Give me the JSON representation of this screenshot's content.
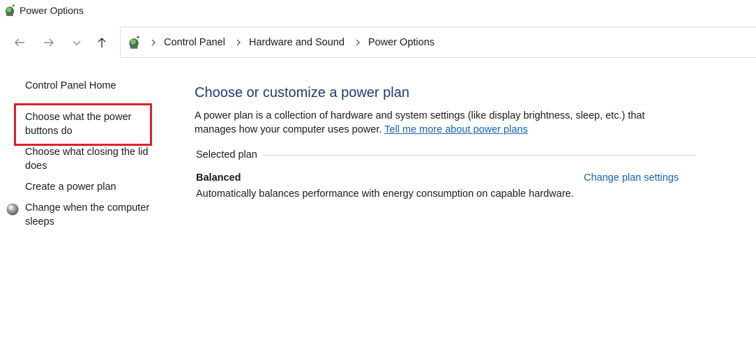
{
  "window": {
    "title": "Power Options"
  },
  "breadcrumb": [
    "Control Panel",
    "Hardware and Sound",
    "Power Options"
  ],
  "sidebar": {
    "items": [
      "Control Panel Home",
      "Choose what the power buttons do",
      "Choose what closing the lid does",
      "Create a power plan",
      "Change when the computer sleeps"
    ]
  },
  "main": {
    "title": "Choose or customize a power plan",
    "description": "A power plan is a collection of hardware and system settings (like display brightness, sleep, etc.) that manages how your computer uses power. ",
    "learn_more_link": "Tell me more about power plans",
    "section_label": "Selected plan",
    "plan": {
      "name": "Balanced",
      "settings_link": "Change plan settings",
      "description": "Automatically balances performance with energy consumption on capable hardware."
    }
  },
  "colors": {
    "highlight": "#e0202a",
    "link": "#1560c4",
    "title": "#1e3c78"
  },
  "icons": {
    "app": "power-options-icon",
    "back": "arrow-left-icon",
    "forward": "arrow-right-icon",
    "recent": "chevron-down-icon",
    "up": "arrow-up-icon",
    "sleep": "moon-globe-icon"
  }
}
